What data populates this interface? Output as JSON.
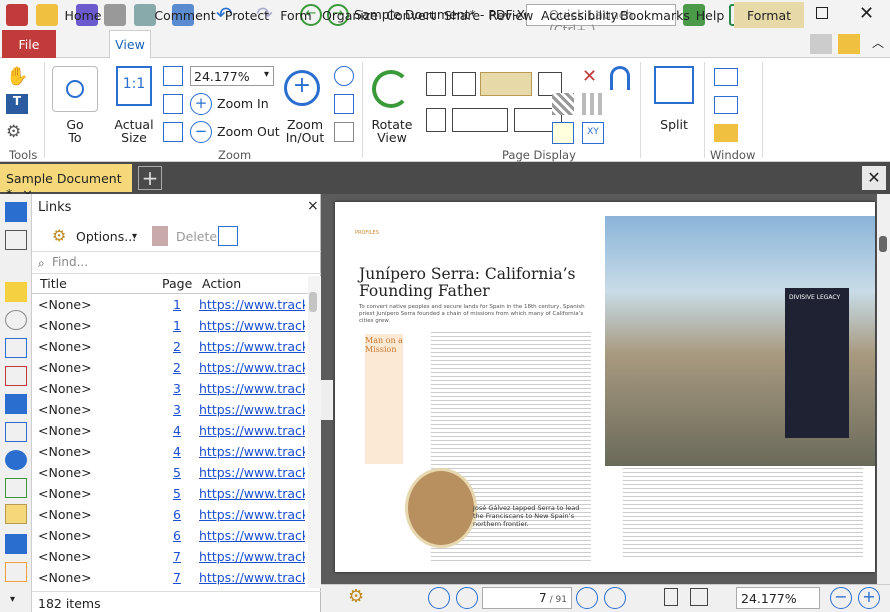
{
  "title_bar": {
    "title": "Sample Document* - PDF-XCh...",
    "quick_launch_placeholder": "Quick Launch (Ctrl+.)"
  },
  "ribbon_tabs": [
    "File",
    "Home",
    "View",
    "Comment",
    "Protect",
    "Form",
    "Organize",
    "Convert",
    "Share",
    "Review",
    "Accessibility",
    "Bookmarks",
    "Help",
    "Format"
  ],
  "ribbon": {
    "tools_group": "Tools",
    "zoom_group": "Zoom",
    "page_display_group": "Page Display",
    "window_group": "Window",
    "go_to": "Go\nTo",
    "actual_size": "Actual\nSize",
    "zoom_value": "24.177%",
    "zoom_in": "Zoom In",
    "zoom_out": "Zoom Out",
    "zoom_in_out": "Zoom\nIn/Out",
    "rotate_view": "Rotate\nView",
    "split": "Split"
  },
  "doc_tab": {
    "label": "Sample Document *"
  },
  "links_panel": {
    "title": "Links",
    "options": "Options...",
    "delete": "Delete",
    "find_placeholder": "Find...",
    "columns": [
      "Title",
      "Page",
      "Action"
    ],
    "rows": [
      {
        "title": "<None>",
        "page": "1",
        "action": "https://www.tracker"
      },
      {
        "title": "<None>",
        "page": "1",
        "action": "https://www.tracker"
      },
      {
        "title": "<None>",
        "page": "2",
        "action": "https://www.tracker"
      },
      {
        "title": "<None>",
        "page": "2",
        "action": "https://www.tracker"
      },
      {
        "title": "<None>",
        "page": "3",
        "action": "https://www.tracker"
      },
      {
        "title": "<None>",
        "page": "3",
        "action": "https://www.tracker"
      },
      {
        "title": "<None>",
        "page": "4",
        "action": "https://www.tracker"
      },
      {
        "title": "<None>",
        "page": "4",
        "action": "https://www.tracker"
      },
      {
        "title": "<None>",
        "page": "5",
        "action": "https://www.tracker"
      },
      {
        "title": "<None>",
        "page": "5",
        "action": "https://www.tracker"
      },
      {
        "title": "<None>",
        "page": "6",
        "action": "https://www.tracker"
      },
      {
        "title": "<None>",
        "page": "6",
        "action": "https://www.tracker"
      },
      {
        "title": "<None>",
        "page": "7",
        "action": "https://www.tracker"
      },
      {
        "title": "<None>",
        "page": "7",
        "action": "https://www.tracker"
      }
    ],
    "status": "182 items"
  },
  "document": {
    "kicker": "PROFILES",
    "headline": "Junípero Serra: California’s Founding Father",
    "dek": "To convert native peoples and secure lands for Spain in the 18th century, Spanish priest Junípero Serra founded a chain of missions from which many of California’s cities grew.",
    "sidebar_title": "Man on a Mission",
    "caption": "José Gálvez tapped Serra to lead the Franciscans to New Spain’s northern frontier.",
    "legacy_title": "DIVISIVE LEGACY"
  },
  "bottom_bar": {
    "page_display": "7",
    "page_total": "/ 91",
    "zoom": "24.177%"
  }
}
